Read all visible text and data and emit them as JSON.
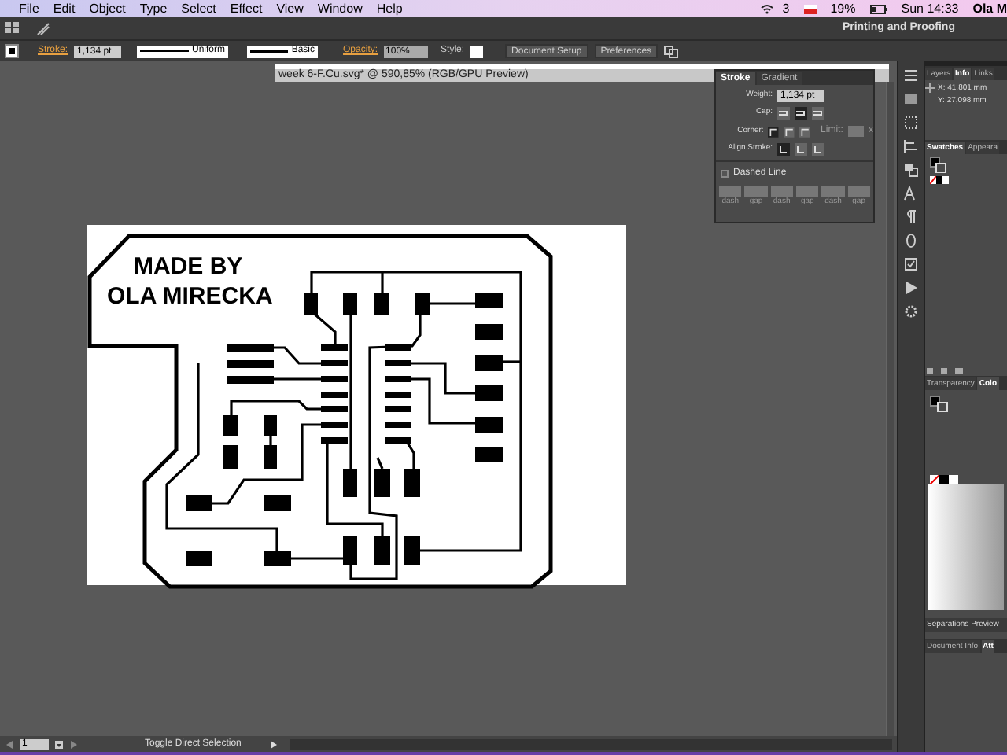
{
  "menu_bar": {
    "items": [
      "File",
      "Edit",
      "Object",
      "Type",
      "Select",
      "Effect",
      "View",
      "Window",
      "Help"
    ],
    "adobe_count": "3",
    "battery": "19%",
    "clock": "Sun 14:33",
    "user": "Ola M"
  },
  "workspace": "Printing and Proofing",
  "control_bar": {
    "stroke_label": "Stroke:",
    "stroke_weight": "1,134 pt",
    "profile": "Uniform",
    "brush": "Basic",
    "opacity_label": "Opacity:",
    "opacity": "100%",
    "style_label": "Style:",
    "buttons": [
      "Document Setup",
      "Preferences"
    ]
  },
  "document_tab": {
    "title": "week 6-F.Cu.svg* @ 590,85% (RGB/GPU Preview)"
  },
  "artboard": {
    "lines": [
      "MADE BY",
      "OLA MIRECKA"
    ]
  },
  "stroke_panel": {
    "tabs": [
      {
        "label": "Stroke",
        "selected": true
      },
      {
        "label": "Gradient",
        "selected": false
      }
    ],
    "weight_label": "Weight:",
    "weight": "1,134 pt",
    "cap_label": "Cap:",
    "corner_label": "Corner:",
    "limit_label": "Limit:",
    "limit_unit": "x",
    "align_label": "Align Stroke:",
    "dashed": {
      "label": "Dashed Line",
      "checked": false
    },
    "dash_labels": [
      "dash",
      "gap",
      "dash",
      "gap",
      "dash",
      "gap"
    ]
  },
  "info_panel": {
    "tabs": [
      {
        "label": "Layers",
        "selected": false
      },
      {
        "label": "Info",
        "selected": true
      },
      {
        "label": "Links",
        "selected": false
      }
    ],
    "x": "X: 41,801 mm",
    "y": "Y: 27,098 mm"
  },
  "swatches_panel": {
    "tabs": [
      {
        "label": "Swatches",
        "selected": true
      },
      {
        "label": "Appeara",
        "selected": false
      }
    ]
  },
  "color_panel": {
    "tabs": [
      {
        "label": "Transparency",
        "selected": false
      },
      {
        "label": "Colo",
        "selected": true
      }
    ]
  },
  "separations_panel": {
    "title": "Separations Preview"
  },
  "bottom_tabs": [
    {
      "label": "Document Info",
      "selected": false
    },
    {
      "label": "Att",
      "selected": true
    }
  ],
  "status_bar": {
    "page": "1",
    "tool": "Toggle Direct Selection"
  }
}
